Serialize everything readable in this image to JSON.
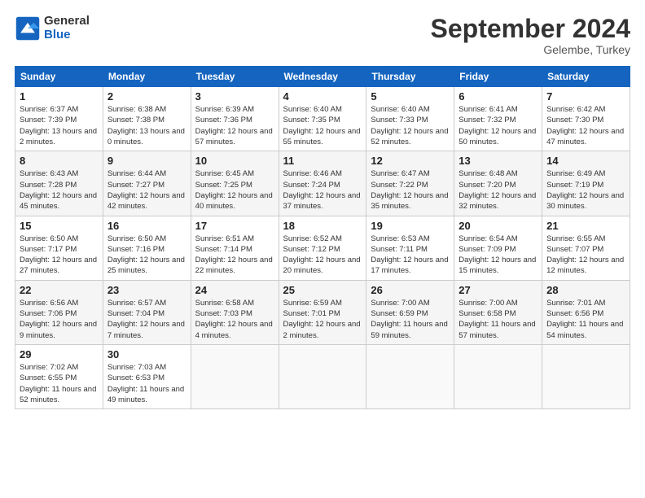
{
  "header": {
    "logo_general": "General",
    "logo_blue": "Blue",
    "month_title": "September 2024",
    "location": "Gelembe, Turkey"
  },
  "days_of_week": [
    "Sunday",
    "Monday",
    "Tuesday",
    "Wednesday",
    "Thursday",
    "Friday",
    "Saturday"
  ],
  "weeks": [
    [
      {
        "day": "1",
        "sunrise": "Sunrise: 6:37 AM",
        "sunset": "Sunset: 7:39 PM",
        "daylight": "Daylight: 13 hours and 2 minutes."
      },
      {
        "day": "2",
        "sunrise": "Sunrise: 6:38 AM",
        "sunset": "Sunset: 7:38 PM",
        "daylight": "Daylight: 13 hours and 0 minutes."
      },
      {
        "day": "3",
        "sunrise": "Sunrise: 6:39 AM",
        "sunset": "Sunset: 7:36 PM",
        "daylight": "Daylight: 12 hours and 57 minutes."
      },
      {
        "day": "4",
        "sunrise": "Sunrise: 6:40 AM",
        "sunset": "Sunset: 7:35 PM",
        "daylight": "Daylight: 12 hours and 55 minutes."
      },
      {
        "day": "5",
        "sunrise": "Sunrise: 6:40 AM",
        "sunset": "Sunset: 7:33 PM",
        "daylight": "Daylight: 12 hours and 52 minutes."
      },
      {
        "day": "6",
        "sunrise": "Sunrise: 6:41 AM",
        "sunset": "Sunset: 7:32 PM",
        "daylight": "Daylight: 12 hours and 50 minutes."
      },
      {
        "day": "7",
        "sunrise": "Sunrise: 6:42 AM",
        "sunset": "Sunset: 7:30 PM",
        "daylight": "Daylight: 12 hours and 47 minutes."
      }
    ],
    [
      {
        "day": "8",
        "sunrise": "Sunrise: 6:43 AM",
        "sunset": "Sunset: 7:28 PM",
        "daylight": "Daylight: 12 hours and 45 minutes."
      },
      {
        "day": "9",
        "sunrise": "Sunrise: 6:44 AM",
        "sunset": "Sunset: 7:27 PM",
        "daylight": "Daylight: 12 hours and 42 minutes."
      },
      {
        "day": "10",
        "sunrise": "Sunrise: 6:45 AM",
        "sunset": "Sunset: 7:25 PM",
        "daylight": "Daylight: 12 hours and 40 minutes."
      },
      {
        "day": "11",
        "sunrise": "Sunrise: 6:46 AM",
        "sunset": "Sunset: 7:24 PM",
        "daylight": "Daylight: 12 hours and 37 minutes."
      },
      {
        "day": "12",
        "sunrise": "Sunrise: 6:47 AM",
        "sunset": "Sunset: 7:22 PM",
        "daylight": "Daylight: 12 hours and 35 minutes."
      },
      {
        "day": "13",
        "sunrise": "Sunrise: 6:48 AM",
        "sunset": "Sunset: 7:20 PM",
        "daylight": "Daylight: 12 hours and 32 minutes."
      },
      {
        "day": "14",
        "sunrise": "Sunrise: 6:49 AM",
        "sunset": "Sunset: 7:19 PM",
        "daylight": "Daylight: 12 hours and 30 minutes."
      }
    ],
    [
      {
        "day": "15",
        "sunrise": "Sunrise: 6:50 AM",
        "sunset": "Sunset: 7:17 PM",
        "daylight": "Daylight: 12 hours and 27 minutes."
      },
      {
        "day": "16",
        "sunrise": "Sunrise: 6:50 AM",
        "sunset": "Sunset: 7:16 PM",
        "daylight": "Daylight: 12 hours and 25 minutes."
      },
      {
        "day": "17",
        "sunrise": "Sunrise: 6:51 AM",
        "sunset": "Sunset: 7:14 PM",
        "daylight": "Daylight: 12 hours and 22 minutes."
      },
      {
        "day": "18",
        "sunrise": "Sunrise: 6:52 AM",
        "sunset": "Sunset: 7:12 PM",
        "daylight": "Daylight: 12 hours and 20 minutes."
      },
      {
        "day": "19",
        "sunrise": "Sunrise: 6:53 AM",
        "sunset": "Sunset: 7:11 PM",
        "daylight": "Daylight: 12 hours and 17 minutes."
      },
      {
        "day": "20",
        "sunrise": "Sunrise: 6:54 AM",
        "sunset": "Sunset: 7:09 PM",
        "daylight": "Daylight: 12 hours and 15 minutes."
      },
      {
        "day": "21",
        "sunrise": "Sunrise: 6:55 AM",
        "sunset": "Sunset: 7:07 PM",
        "daylight": "Daylight: 12 hours and 12 minutes."
      }
    ],
    [
      {
        "day": "22",
        "sunrise": "Sunrise: 6:56 AM",
        "sunset": "Sunset: 7:06 PM",
        "daylight": "Daylight: 12 hours and 9 minutes."
      },
      {
        "day": "23",
        "sunrise": "Sunrise: 6:57 AM",
        "sunset": "Sunset: 7:04 PM",
        "daylight": "Daylight: 12 hours and 7 minutes."
      },
      {
        "day": "24",
        "sunrise": "Sunrise: 6:58 AM",
        "sunset": "Sunset: 7:03 PM",
        "daylight": "Daylight: 12 hours and 4 minutes."
      },
      {
        "day": "25",
        "sunrise": "Sunrise: 6:59 AM",
        "sunset": "Sunset: 7:01 PM",
        "daylight": "Daylight: 12 hours and 2 minutes."
      },
      {
        "day": "26",
        "sunrise": "Sunrise: 7:00 AM",
        "sunset": "Sunset: 6:59 PM",
        "daylight": "Daylight: 11 hours and 59 minutes."
      },
      {
        "day": "27",
        "sunrise": "Sunrise: 7:00 AM",
        "sunset": "Sunset: 6:58 PM",
        "daylight": "Daylight: 11 hours and 57 minutes."
      },
      {
        "day": "28",
        "sunrise": "Sunrise: 7:01 AM",
        "sunset": "Sunset: 6:56 PM",
        "daylight": "Daylight: 11 hours and 54 minutes."
      }
    ],
    [
      {
        "day": "29",
        "sunrise": "Sunrise: 7:02 AM",
        "sunset": "Sunset: 6:55 PM",
        "daylight": "Daylight: 11 hours and 52 minutes."
      },
      {
        "day": "30",
        "sunrise": "Sunrise: 7:03 AM",
        "sunset": "Sunset: 6:53 PM",
        "daylight": "Daylight: 11 hours and 49 minutes."
      },
      null,
      null,
      null,
      null,
      null
    ]
  ]
}
